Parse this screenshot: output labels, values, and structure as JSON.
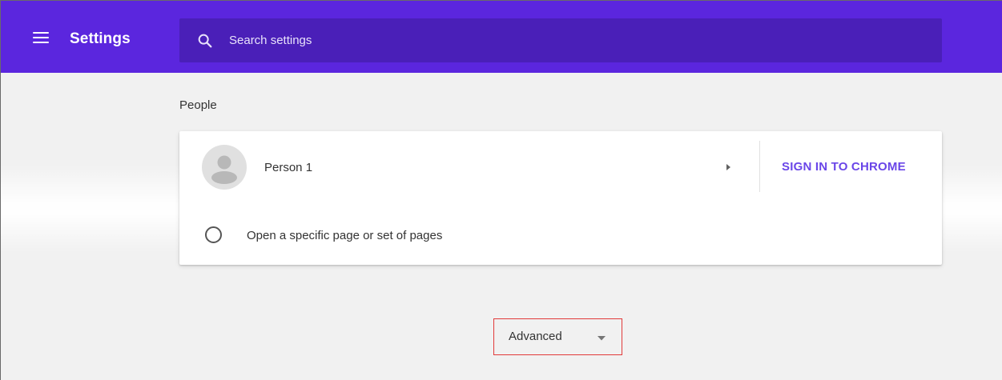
{
  "app": {
    "title": "Settings"
  },
  "search": {
    "placeholder": "Search settings"
  },
  "people_section": {
    "title": "People",
    "person": {
      "name": "Person 1"
    },
    "sign_in_label": "SIGN IN TO CHROME",
    "startup_option": {
      "label": "Open a specific page or set of pages",
      "checked": false
    }
  },
  "advanced": {
    "label": "Advanced"
  },
  "icons": {
    "menu": "menu-icon",
    "search": "search-icon",
    "avatar": "avatar-icon",
    "arrow": "arrow-right-icon",
    "caret": "caret-down-icon"
  },
  "colors": {
    "toolbar": "#5b26de",
    "search_box": "#4a1fb8",
    "accent": "#6a46e8",
    "highlight": "#e23a3a",
    "background": "#f1f1f1"
  }
}
